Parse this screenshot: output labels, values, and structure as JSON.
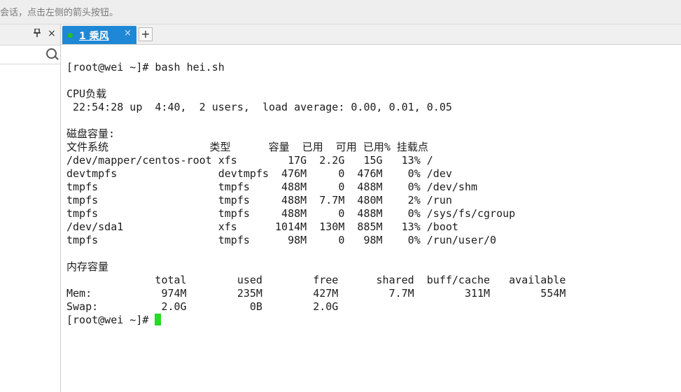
{
  "header": {
    "hint": "会话，点击左侧的箭头按钮。"
  },
  "left_panel": {
    "pin_icon": "pin-icon",
    "close_glyph": "×"
  },
  "tabs": [
    {
      "label": "1 乘风",
      "close": "×",
      "status_color": "#22c21c"
    }
  ],
  "add_tab_label": "+",
  "colors": {
    "tab_active": "#1e88d6",
    "cursor": "#22dd22"
  },
  "terminal": {
    "lines": [
      "[root@wei ~]# bash hei.sh",
      "",
      "CPU负载",
      " 22:54:28 up  4:40,  2 users,  load average: 0.00, 0.01, 0.05",
      "",
      "磁盘容量:",
      "文件系统                类型      容量  已用  可用 已用% 挂载点",
      "/dev/mapper/centos-root xfs        17G  2.2G   15G   13% /",
      "devtmpfs                devtmpfs  476M     0  476M    0% /dev",
      "tmpfs                   tmpfs     488M     0  488M    0% /dev/shm",
      "tmpfs                   tmpfs     488M  7.7M  480M    2% /run",
      "tmpfs                   tmpfs     488M     0  488M    0% /sys/fs/cgroup",
      "/dev/sda1               xfs      1014M  130M  885M   13% /boot",
      "tmpfs                   tmpfs      98M     0   98M    0% /run/user/0",
      "",
      "内存容量",
      "              total        used        free      shared  buff/cache   available",
      "Mem:           974M        235M        427M        7.7M        311M        554M",
      "Swap:          2.0G          0B        2.0G",
      "[root@wei ~]# "
    ]
  }
}
